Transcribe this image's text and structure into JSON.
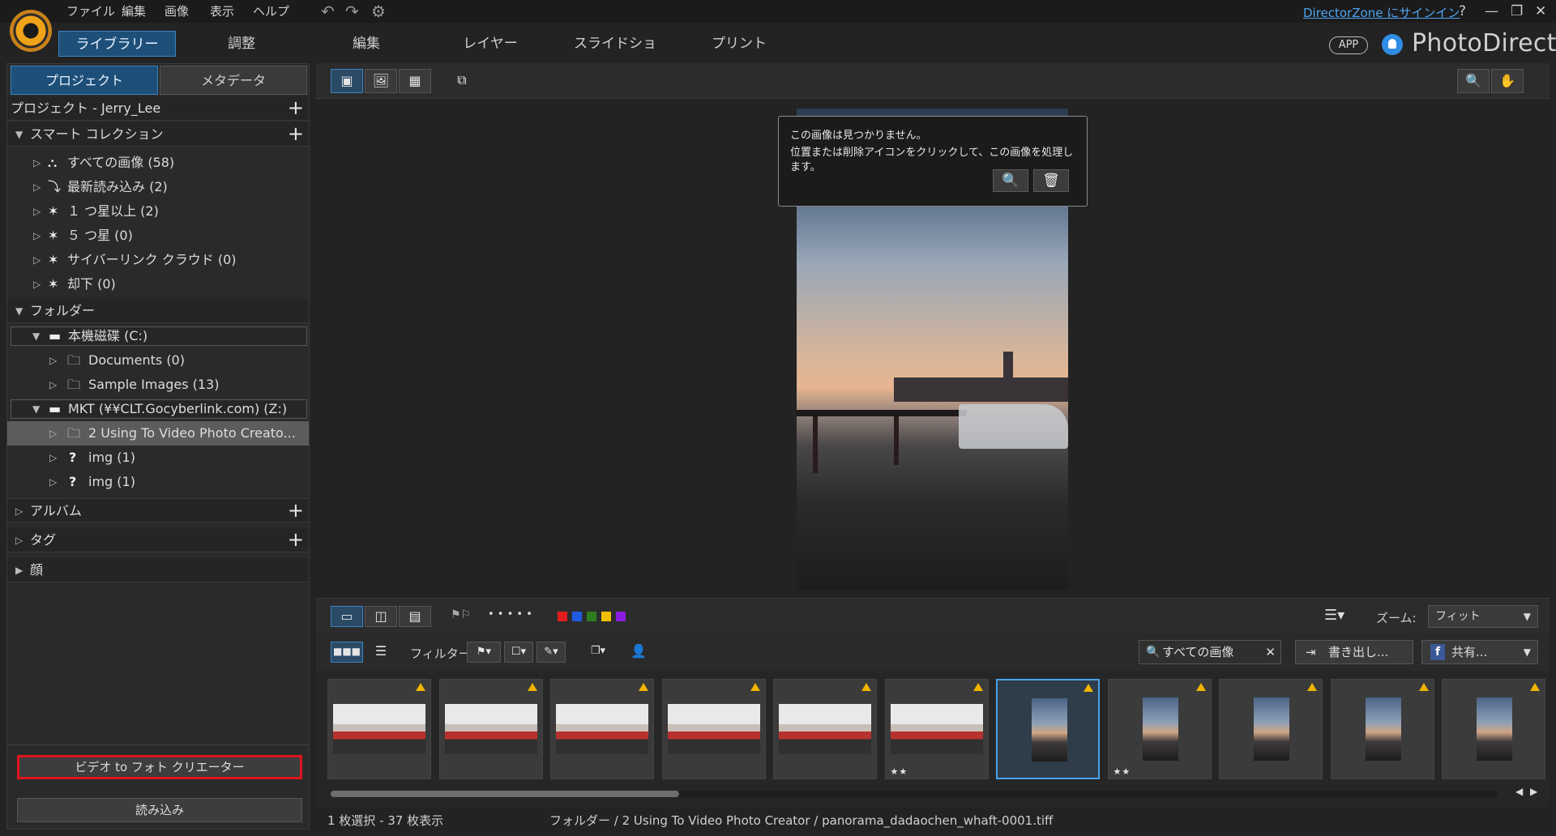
{
  "menu": [
    "ファイル",
    "編集",
    "画像",
    "表示",
    "ヘルプ"
  ],
  "signin": "DirectorZone にサインイン",
  "window_buttons": [
    "?",
    "—",
    "❐",
    "✕"
  ],
  "modules": [
    "ライブラリー",
    "調整",
    "編集",
    "レイヤー",
    "スライドショー",
    "プリント"
  ],
  "app_badge": "APP",
  "brand": "PhotoDirector",
  "left": {
    "tabs": [
      "プロジェクト",
      "メタデータ"
    ],
    "project": "プロジェクト - Jerry_Lee",
    "smart_header": "スマート コレクション",
    "smart_items": [
      "すべての画像 (58)",
      "最新読み込み (2)",
      "１ つ星以上 (2)",
      "５ つ星 (0)",
      "サイバーリンク クラウド (0)",
      "却下 (0)"
    ],
    "folder_header": "フォルダー",
    "drive_c": "本機磁碟 (C:)",
    "drive_c_items": [
      "Documents (0)",
      "Sample Images (13)"
    ],
    "drive_z": "MKT (¥¥CLT.Gocyberlink.com) (Z:)",
    "drive_z_items": [
      "2 Using To Video Photo Creato...",
      "img (1)",
      "img (1)"
    ],
    "album": "アルバム",
    "tag": "タグ",
    "face": "顔",
    "video_btn": "ビデオ to フォト クリエーター",
    "import_btn": "読み込み"
  },
  "viewer": {
    "notfound_title": "この画像は見つかりません。",
    "notfound_body": "位置または削除アイコンをクリックして、この画像を処理します。"
  },
  "view_toolbar": {
    "rating_dots": "• • • • •",
    "colors": [
      "#e01e1e",
      "#1e5be0",
      "#2e7d1e",
      "#f0c000",
      "#8a1ee0"
    ],
    "zoom_label": "ズーム:",
    "zoom_value": "フィット"
  },
  "filter_bar": {
    "filter_label": "フィルター:",
    "search_value": "すべての画像",
    "export_btn": "書き出し...",
    "share_btn": "共有..."
  },
  "filmstrip": {
    "thumbs": [
      {
        "kind": "group",
        "stars": "",
        "selected": false
      },
      {
        "kind": "group",
        "stars": "",
        "selected": false
      },
      {
        "kind": "group",
        "stars": "",
        "selected": false
      },
      {
        "kind": "group",
        "stars": "",
        "selected": false
      },
      {
        "kind": "group",
        "stars": "",
        "selected": false
      },
      {
        "kind": "group",
        "stars": "★★",
        "selected": false
      },
      {
        "kind": "sunset",
        "stars": "",
        "selected": true
      },
      {
        "kind": "sunset",
        "stars": "★★",
        "selected": false
      },
      {
        "kind": "sunset",
        "stars": "",
        "selected": false
      },
      {
        "kind": "sunset",
        "stars": "",
        "selected": false
      },
      {
        "kind": "sunset",
        "stars": "",
        "selected": false
      }
    ]
  },
  "status": {
    "selection": "1 枚選択 - 37 枚表示",
    "path": "フォルダー / 2 Using To Video Photo Creator / panorama_dadaochen_whaft-0001.tiff"
  }
}
